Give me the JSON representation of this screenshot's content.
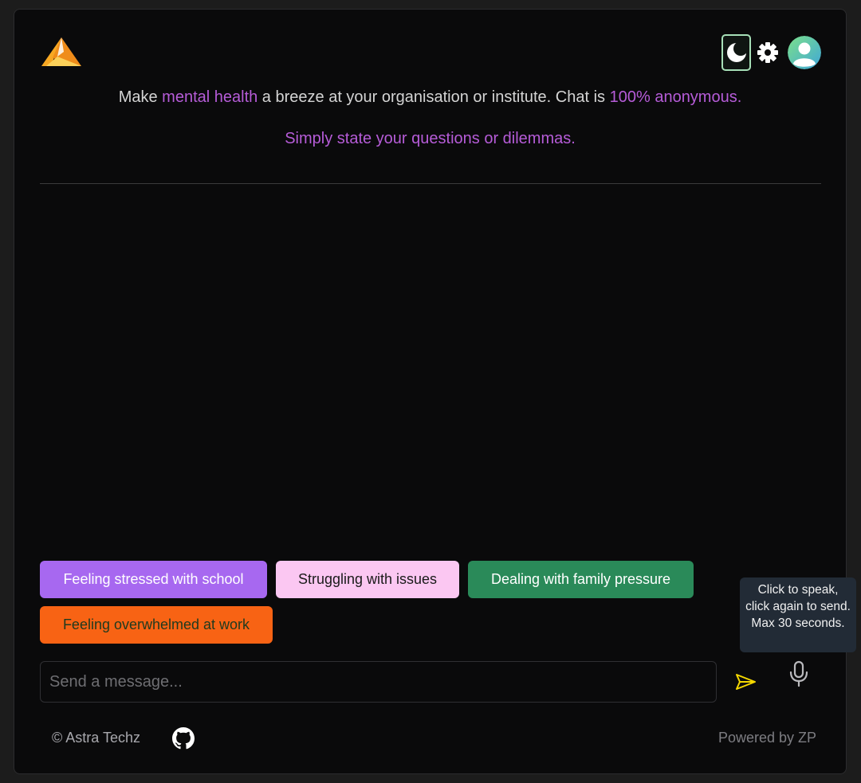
{
  "header": {
    "logo_icon": "astra-logo-icon",
    "theme_toggle_icon": "moon-icon",
    "settings_icon": "gear-icon",
    "avatar_icon": "user-avatar-icon"
  },
  "tagline": {
    "part1": "Make ",
    "highlight1": "mental health",
    "part2": " a breeze at your organisation or institute. Chat is ",
    "highlight2": "100% anonymous."
  },
  "subtagline": "Simply state your questions or dilemmas.",
  "suggestions": [
    {
      "label": "Feeling stressed with school",
      "color": "#a768f0"
    },
    {
      "label": "Struggling with issues",
      "color": "#fbc7f2"
    },
    {
      "label": "Dealing with family pressure",
      "color": "#2a8a59"
    },
    {
      "label": "Feeling overwhelmed at work",
      "color": "#f86314"
    }
  ],
  "composer": {
    "placeholder": "Send a message...",
    "value": "",
    "send_icon": "send-icon",
    "mic_icon": "microphone-icon",
    "mic_tooltip": "Click to speak, click again to send. Max 30 seconds."
  },
  "footer": {
    "copyright": "© Astra Techz",
    "github_icon": "github-icon",
    "powered_by": "Powered by  ZP"
  },
  "colors": {
    "accent_purple": "#b65cd8",
    "background": "#0a0a0b",
    "send_icon": "#f5d800"
  }
}
